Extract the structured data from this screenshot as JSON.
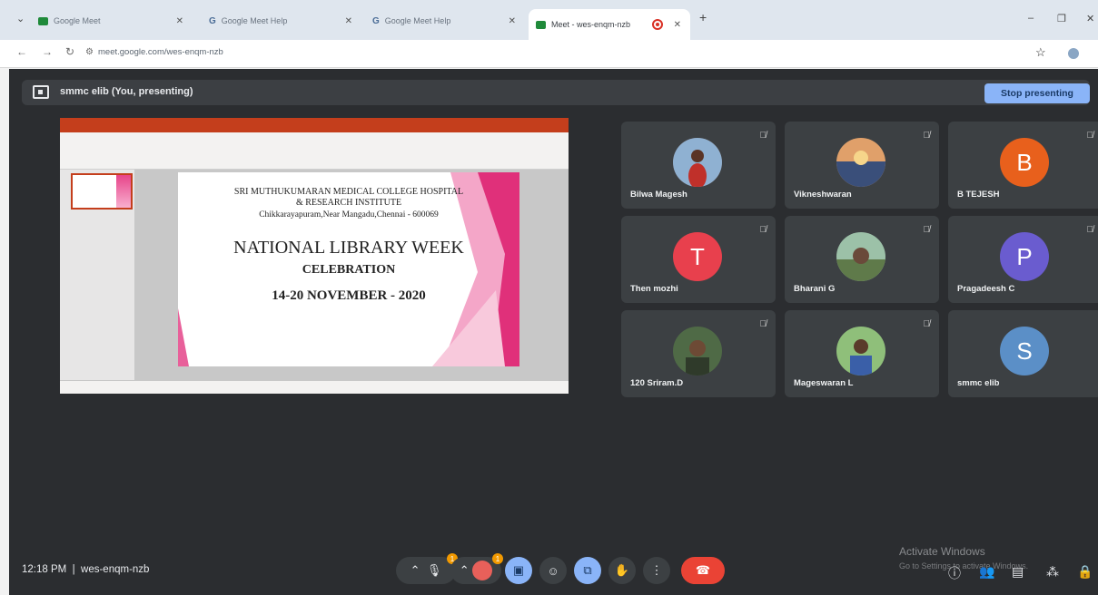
{
  "browser": {
    "tabs": [
      {
        "label": "Google Meet"
      },
      {
        "label": "Google Meet Help"
      },
      {
        "label": "Google Meet Help"
      },
      {
        "label": "Meet - wes-enqm-nzb",
        "active": true
      }
    ],
    "url": "meet.google.com/wes-enqm-nzb"
  },
  "meet": {
    "presenting_text": "smmc elib (You, presenting)",
    "stop_presenting": "Stop presenting",
    "time": "12:18 PM",
    "meeting_code": "wes-enqm-nzb",
    "watermark_title": "Activate Windows",
    "watermark_sub": "Go to Settings to activate Windows."
  },
  "slide": {
    "line1": "SRI MUTHUKUMARAN MEDICAL COLLEGE HOSPITAL",
    "line2": "& RESEARCH INSTITUTE",
    "line3": "Chikkarayapuram,Near Mangadu,Chennai - 600069",
    "line4": "NATIONAL LIBRARY WEEK",
    "line5": "CELEBRATION",
    "line6": "14-20 NOVEMBER  - 2020"
  },
  "participants": [
    {
      "name": "Bilwa Magesh",
      "initial": "",
      "color": "#7a4a3a"
    },
    {
      "name": "Vikneshwaran",
      "initial": "",
      "color": "#3a4f7a"
    },
    {
      "name": "B TEJESH",
      "initial": "B",
      "color": "#e8601c"
    },
    {
      "name": "Then mozhi",
      "initial": "T",
      "color": "#e8404d"
    },
    {
      "name": "Bharani G",
      "initial": "",
      "color": "#5f7a4a"
    },
    {
      "name": "Pragadeesh C",
      "initial": "P",
      "color": "#6a5ccf"
    },
    {
      "name": "120 Sriram.D",
      "initial": "",
      "color": "#3f5f3a"
    },
    {
      "name": "Mageswaran L",
      "initial": "",
      "color": "#5a7e5a"
    },
    {
      "name": "smmc elib",
      "initial": "S",
      "color": "#5b8fc7"
    }
  ],
  "badges": {
    "mic": "1",
    "cam": "1"
  }
}
